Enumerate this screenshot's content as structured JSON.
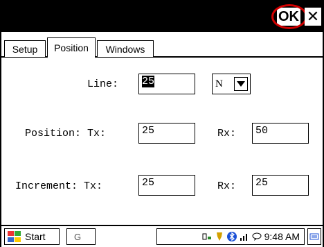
{
  "titlebar": {
    "ok_label": "OK",
    "close_symbol": "✕"
  },
  "tabs": [
    {
      "label": "Setup",
      "active": false
    },
    {
      "label": "Position",
      "active": true
    },
    {
      "label": "Windows",
      "active": false
    }
  ],
  "form": {
    "line_label": "Line:",
    "line_value": "25",
    "direction_value": "N",
    "position_label": "Position: Tx:",
    "position_tx_value": "25",
    "position_rx_label": "Rx:",
    "position_rx_value": "50",
    "increment_label": "Increment: Tx:",
    "increment_tx_value": "25",
    "increment_rx_label": "Rx:",
    "increment_rx_value": "25"
  },
  "taskbar": {
    "start_label": "Start",
    "task_text": "G",
    "time": "9:48 AM"
  },
  "icons": {
    "start": "windows-flag-icon",
    "tray": [
      "network-icon",
      "power-icon",
      "bluetooth-icon",
      "signal-icon",
      "messaging-icon"
    ],
    "keyboard": "keyboard-icon"
  },
  "colors": {
    "titlebar": "#000000",
    "highlight": "#d00000",
    "bluetooth": "#1a4fd6"
  }
}
